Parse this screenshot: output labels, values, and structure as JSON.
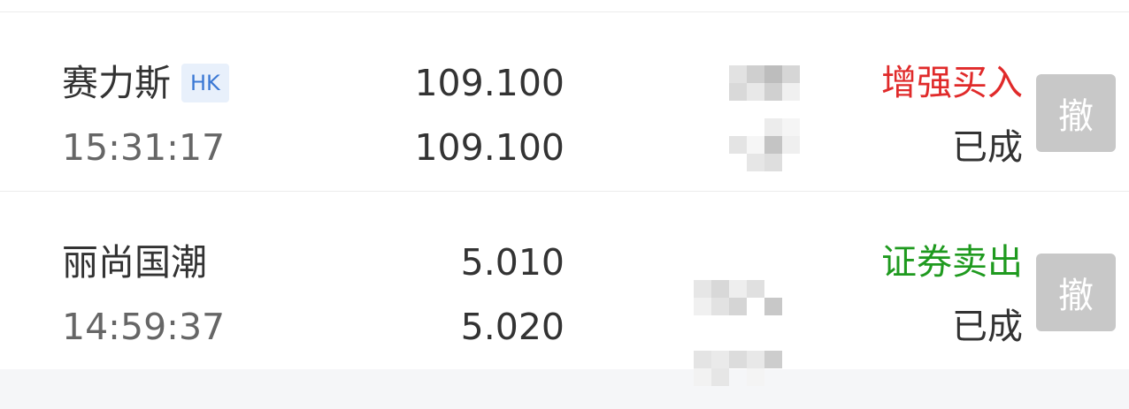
{
  "orders": [
    {
      "name": "赛力斯",
      "market_tag": "HK",
      "time": "15:31:17",
      "order_price": "109.100",
      "fill_price": "109.100",
      "type": "增强买入",
      "type_color": "#e02a2a",
      "status": "已成",
      "cancel_label": "撤"
    },
    {
      "name": "丽尚国潮",
      "market_tag": "",
      "time": "14:59:37",
      "order_price": "5.010",
      "fill_price": "5.020",
      "type": "证券卖出",
      "type_color": "#1f9a1f",
      "status": "已成",
      "cancel_label": "撤"
    }
  ],
  "colors": {
    "page_bg": "#f5f6f8",
    "row_bg": "#ffffff",
    "cancel_button_bg": "#c8c8c8",
    "tag_bg": "#e8f0fb",
    "tag_text": "#3a78d4"
  }
}
